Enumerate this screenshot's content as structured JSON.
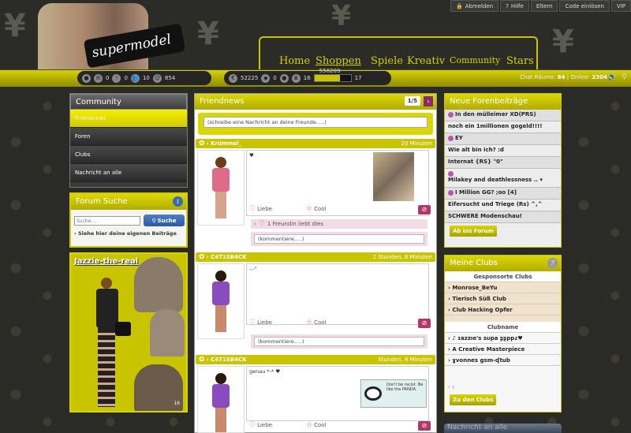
{
  "topbar": {
    "logout": "Abmelden",
    "help": "Hilfe",
    "parents": "Eltern",
    "redeem_code": "Code einlösen",
    "vip": "VIP"
  },
  "logo": {
    "text": "supermodel"
  },
  "nav": [
    "Home",
    "Shoppen",
    "Spiele",
    "Kreativ",
    "Community",
    "Stars"
  ],
  "status": {
    "messages": "0",
    "alerts": "0",
    "friends": "10",
    "smileys": "854",
    "coins": "52225",
    "diamonds": "0",
    "level_current": "16",
    "level_next": "17",
    "xp": "558209"
  },
  "chat": {
    "label_rooms": "Chat Räume:",
    "rooms": "84",
    "label_online": "Online:",
    "online": "2304"
  },
  "community": {
    "title": "Community",
    "items": [
      "Friendnews",
      "Foren",
      "Clubs",
      "Nachricht an alle"
    ]
  },
  "forum_search": {
    "title": "Forum Suche",
    "placeholder": "Suche....",
    "button": "Suche",
    "link": "› Siehe hier deine eigenen Beiträge"
  },
  "profile": {
    "name": "Jazzie-the-real",
    "count": "16"
  },
  "friendnews": {
    "title": "Friendnews",
    "page": "1/5",
    "input_placeholder": "(schreibe eine Nachricht an deine Freunde.....)",
    "posts": [
      {
        "name": "› Krümmel_",
        "time": "20 Minuten",
        "text": "♥",
        "like": "Liebe",
        "cool": "Cool",
        "friend_like": "1 Freundin liebt dies",
        "comment": "(kommentiere.....)"
      },
      {
        "name": "› C4T1SB4CK",
        "time": "2 Stunden, 6 Minuten",
        "text": "-.-\"",
        "like": "Liebe",
        "cool": "Cool",
        "comment": "(kommentiere.....)"
      },
      {
        "name": "› C4T1SB4CK",
        "time": "Stunden, 8 Minuten",
        "text": "genau *-* ♥",
        "like": "Liebe",
        "cool": "Cool",
        "image_text": "Don't be racist. Be like the PANDA."
      }
    ]
  },
  "forum": {
    "title": "Neue Forenbeiträge",
    "items": [
      "In den mülleimer XD(PRS)",
      "noch ein 1millionen gogeld!!!!",
      "EY",
      "Wie alt bin ich? :d",
      "Internat {RS} \"0\"",
      "Milakey and deathlessness .. ▾",
      "I Million GG? ;oo [4]",
      "Eifersucht und Triege (Rs) ^,^",
      "SCHWERE Modenschau!"
    ],
    "button": "Ab ins Forum"
  },
  "clubs": {
    "title": "Meine Clubs",
    "sponsored_header": "Gesponsorte Clubs",
    "sponsored": [
      "Monrose_BeYu",
      "Tierisch Süß Club",
      "Club Hacking Opfer"
    ],
    "clubname_header": "Clubname",
    "clubs": [
      "♪ ɪazzıe's sυpa ʂʂppɾ♥",
      "A Creative Masterpiece",
      "ɣvonnes gsm-ʠtub"
    ],
    "more": "› ▿",
    "button": "Zu den Clubs"
  },
  "nachricht": {
    "title": "Nachricht an alle"
  },
  "colors": {
    "accent": "#c8c400",
    "dark": "#2b2b28",
    "pink": "#b0396a",
    "blue": "#2d5aa0"
  }
}
